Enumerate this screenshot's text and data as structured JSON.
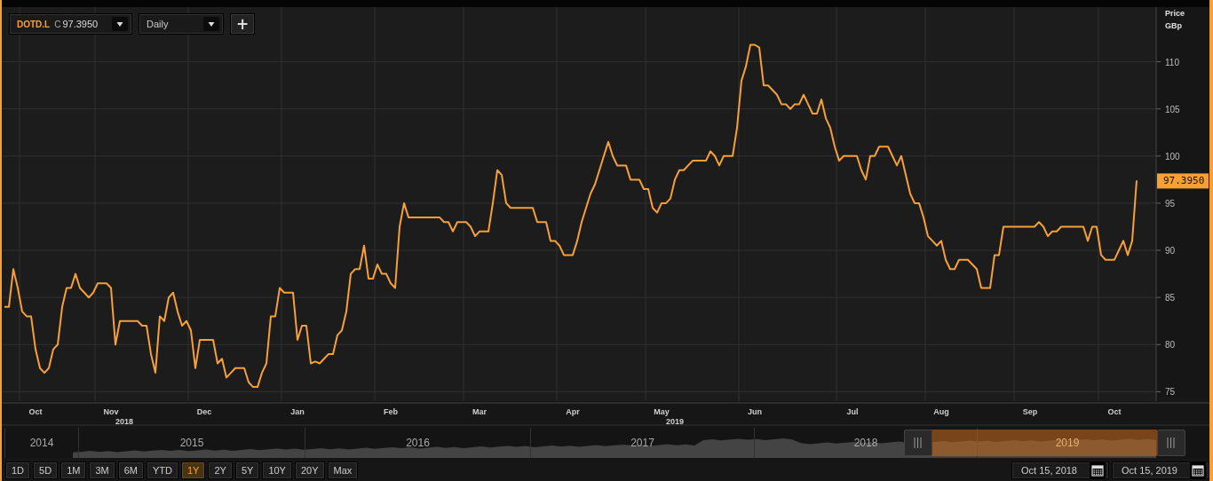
{
  "toolbar": {
    "close_label": "C",
    "close": "97.3950",
    "interval": "Daily",
    "add_button": "+"
  },
  "chart": {
    "axis_title": "Price",
    "axis_unit": "GBp",
    "last_price": "97.3950",
    "year_labels": [
      "2018",
      "2019"
    ],
    "chart_data": {
      "type": "line",
      "grid": true,
      "ylim": [
        74,
        115.8
      ],
      "yticks": [
        75,
        80,
        85,
        90,
        95,
        100,
        105,
        110
      ],
      "categories": [
        null,
        null,
        null,
        null,
        null,
        null,
        null,
        "Oct",
        null,
        null,
        null,
        null,
        null,
        null,
        null,
        null,
        null,
        null,
        null,
        null,
        null,
        null,
        null,
        null,
        "Nov",
        null,
        null,
        null,
        null,
        null,
        null,
        null,
        null,
        null,
        null,
        null,
        null,
        null,
        null,
        null,
        null,
        null,
        null,
        null,
        null,
        "Dec",
        null,
        null,
        null,
        null,
        null,
        null,
        null,
        null,
        null,
        null,
        null,
        null,
        null,
        null,
        null,
        null,
        null,
        null,
        null,
        null,
        "Jan",
        null,
        null,
        null,
        null,
        null,
        null,
        null,
        null,
        null,
        null,
        null,
        null,
        null,
        null,
        null,
        null,
        null,
        null,
        null,
        null,
        "Feb",
        null,
        null,
        null,
        null,
        null,
        null,
        null,
        null,
        null,
        null,
        null,
        null,
        null,
        null,
        null,
        null,
        null,
        null,
        null,
        "Mar",
        null,
        null,
        null,
        null,
        null,
        null,
        null,
        null,
        null,
        null,
        null,
        null,
        null,
        null,
        null,
        null,
        null,
        null,
        null,
        null,
        "Apr",
        null,
        null,
        null,
        null,
        null,
        null,
        null,
        null,
        null,
        null,
        null,
        null,
        null,
        null,
        null,
        null,
        null,
        null,
        null,
        "May",
        null,
        null,
        null,
        null,
        null,
        null,
        null,
        null,
        null,
        null,
        null,
        null,
        null,
        null,
        null,
        null,
        null,
        null,
        null,
        null,
        "Jun",
        null,
        null,
        null,
        null,
        null,
        null,
        null,
        null,
        null,
        null,
        null,
        null,
        null,
        null,
        null,
        null,
        null,
        null,
        null,
        null,
        null,
        "Jul",
        null,
        null,
        null,
        null,
        null,
        null,
        null,
        null,
        null,
        null,
        null,
        null,
        null,
        null,
        null,
        null,
        null,
        null,
        null,
        "Aug",
        null,
        null,
        null,
        null,
        null,
        null,
        null,
        null,
        null,
        null,
        null,
        null,
        null,
        null,
        null,
        null,
        null,
        null,
        null,
        "Sep",
        null,
        null,
        null,
        null,
        null,
        null,
        null,
        null,
        null,
        null,
        null,
        null,
        null,
        null,
        null,
        null,
        null,
        null,
        "Oct",
        null,
        null,
        null,
        null,
        null
      ],
      "series": [
        {
          "name": "DOTD.L",
          "color": "#f7a035",
          "values": [
            84,
            84,
            88,
            86,
            83.5,
            83,
            83,
            79.5,
            77.5,
            77,
            77.5,
            79.5,
            80,
            84,
            86,
            86,
            87.5,
            86,
            85.5,
            85,
            85.5,
            86.5,
            86.5,
            86.5,
            86,
            80,
            82.5,
            82.5,
            82.5,
            82.5,
            82.5,
            82,
            82,
            79,
            77,
            83,
            82.5,
            85,
            85.5,
            83.5,
            82,
            82.5,
            81.5,
            77.5,
            80.5,
            80.5,
            80.5,
            80.5,
            78,
            78.5,
            76.5,
            77,
            77.5,
            77.5,
            77.5,
            76,
            75.5,
            75.5,
            77,
            78,
            83,
            83,
            86,
            85.5,
            85.5,
            85.5,
            80.5,
            82,
            82,
            78,
            78.2,
            78,
            78.5,
            79,
            79,
            81,
            81.5,
            83.5,
            87.5,
            88,
            88,
            90.5,
            87,
            87,
            88.5,
            87.5,
            87.5,
            86.5,
            86,
            92.5,
            95,
            93.5,
            93.5,
            93.5,
            93.5,
            93.5,
            93.5,
            93.5,
            93.5,
            93,
            93,
            92,
            93,
            93,
            93,
            92.5,
            91.5,
            92,
            92,
            92,
            95,
            98.5,
            98,
            95,
            94.5,
            94.5,
            94.5,
            94.5,
            94.5,
            94.5,
            93,
            93,
            93,
            91,
            91,
            90.5,
            89.5,
            89.5,
            89.5,
            91,
            93,
            94.5,
            96,
            97,
            98.5,
            100,
            101.5,
            100,
            99,
            99,
            99,
            97.5,
            97.5,
            97.5,
            96.5,
            96.5,
            94.5,
            94,
            95,
            95,
            95.5,
            97.5,
            98.5,
            98.5,
            99,
            99.5,
            99.5,
            99.5,
            99.5,
            100.5,
            100,
            99,
            100,
            100,
            100,
            103,
            108,
            109.5,
            111.8,
            111.8,
            111.5,
            107.5,
            107.5,
            107,
            106.5,
            105.5,
            105.5,
            105,
            105.5,
            105.5,
            106.5,
            105.5,
            104.5,
            104.5,
            106,
            104,
            103,
            101,
            99.5,
            100,
            100,
            100,
            100,
            98.5,
            97.5,
            100,
            100,
            101,
            101,
            101,
            100,
            99,
            100,
            98,
            96,
            95,
            95,
            93.5,
            91.5,
            91,
            90.5,
            91,
            89,
            88,
            88,
            89,
            89,
            89,
            88.5,
            88,
            86,
            86,
            86,
            89.5,
            89.5,
            92.5,
            92.5,
            92.5,
            92.5,
            92.5,
            92.5,
            92.5,
            92.5,
            93,
            92.5,
            91.5,
            92,
            92,
            92.5,
            92.5,
            92.5,
            92.5,
            92.5,
            92.5,
            91,
            92.5,
            92.5,
            89.5,
            89,
            89,
            89,
            90,
            91,
            89.5,
            91,
            97.4
          ]
        }
      ]
    }
  },
  "navigator": {
    "years": [
      {
        "label": "2014",
        "selected": false
      },
      {
        "label": "2015",
        "selected": false
      },
      {
        "label": "2016",
        "selected": false
      },
      {
        "label": "2017",
        "selected": false
      },
      {
        "label": "2018",
        "selected": false
      },
      {
        "label": "2019",
        "selected": true
      }
    ]
  },
  "ranges": [
    {
      "label": "1D",
      "selected": false
    },
    {
      "label": "5D",
      "selected": false
    },
    {
      "label": "1M",
      "selected": false
    },
    {
      "label": "3M",
      "selected": false
    },
    {
      "label": "6M",
      "selected": false
    },
    {
      "label": "YTD",
      "selected": false
    },
    {
      "label": "1Y",
      "selected": true
    },
    {
      "label": "2Y",
      "selected": false
    },
    {
      "label": "5Y",
      "selected": false
    },
    {
      "label": "10Y",
      "selected": false
    },
    {
      "label": "20Y",
      "selected": false
    },
    {
      "label": "Max",
      "selected": false
    }
  ],
  "date_range": {
    "from": "Oct 15, 2018",
    "to": "Oct 15, 2019"
  }
}
